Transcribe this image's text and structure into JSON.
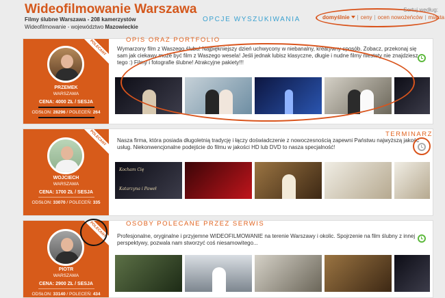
{
  "header": {
    "title": "Wideofilmowanie Warszawa",
    "subtitle": "Filmy ślubne Warszawa - 208 kamerzystów",
    "location_prefix": "Wideofilmowanie - województwo ",
    "location_region": "Mazowieckie",
    "search_options_label": "OPCJE WYSZUKIWANIA",
    "sort_label": "Sortuj według:",
    "sort_options": [
      "domyślnie",
      "ceny",
      "ocen nowożeńców",
      "miasta"
    ]
  },
  "annotations": {
    "portfolio": "OPIS ORAZ PORTFOLIO",
    "schedule": "TERMINARZ",
    "recommended": "OSOBY POLECANE PRZEZ SERWIS"
  },
  "cards": [
    {
      "badge": "POLECANY",
      "name": "PRZEMEK",
      "city": "WARSZAWA",
      "price": "CENA: 4000 ZŁ / SESJA",
      "views_label": "ODSŁON: ",
      "views": "28296",
      "recs_label": " / POLECEŃ: ",
      "recs": "264",
      "description": "Wymarzony film z Waszego ślubu! Najpiękniejszy dzień uchwycony w niebanalny, kreatywny sposób. Zobacz, przekonaj się sam jak ciekawy może być film z Waszego wesela! Jeśli jednak lubisz klasyczne, długie i nudne filmy niestety nie znajdziesz tego :) Filmy i fotografie ślubne! Atrakcyjne pakiety!!!",
      "calendar_icon": "clock-icon",
      "calendar_color": "#5cb83c"
    },
    {
      "badge": "POLECANY",
      "name": "WOJCIECH",
      "city": "WARSZAWA",
      "price": "CENA: 1700 ZŁ / SESJA",
      "views_label": "ODSŁON: ",
      "views": "33070",
      "recs_label": " / POLECEŃ: ",
      "recs": "335",
      "description": "Nasza firma, która posiada długoletnią tradycję i łączy doświadczenie z nowoczesnością zapewni Państwu najwyższą jakość usług. Niekonwencjonalne podejście do filmu w jakości HD lub DVD to nasza specjalność!",
      "thumb_caption_line1": "Kocham Cię",
      "thumb_caption_line2": "Katarzyna i Paweł",
      "calendar_icon": "clock-icon",
      "calendar_color": "#aaaaaa"
    },
    {
      "badge": "POLECANY",
      "name": "PIOTR",
      "city": "WARSZAWA",
      "price": "CENA: 2900 ZŁ / SESJA",
      "views_label": "ODSŁON: ",
      "views": "33140",
      "recs_label": " / POLECEŃ: ",
      "recs": "434",
      "description": "Profesjonalne, oryginalne i przyjemne WIDEOFILMOWANIE na terenie Warszawy i okolic. Spojrzenie na film ślubny z innej perspektywy, pozwala nam stworzyć coś niesamowitego...",
      "calendar_icon": "clock-icon",
      "calendar_color": "#5cb83c"
    }
  ],
  "colors": {
    "brand": "#d75b1a",
    "annotation": "#d9541c",
    "link_blue": "#3aa1d0"
  }
}
